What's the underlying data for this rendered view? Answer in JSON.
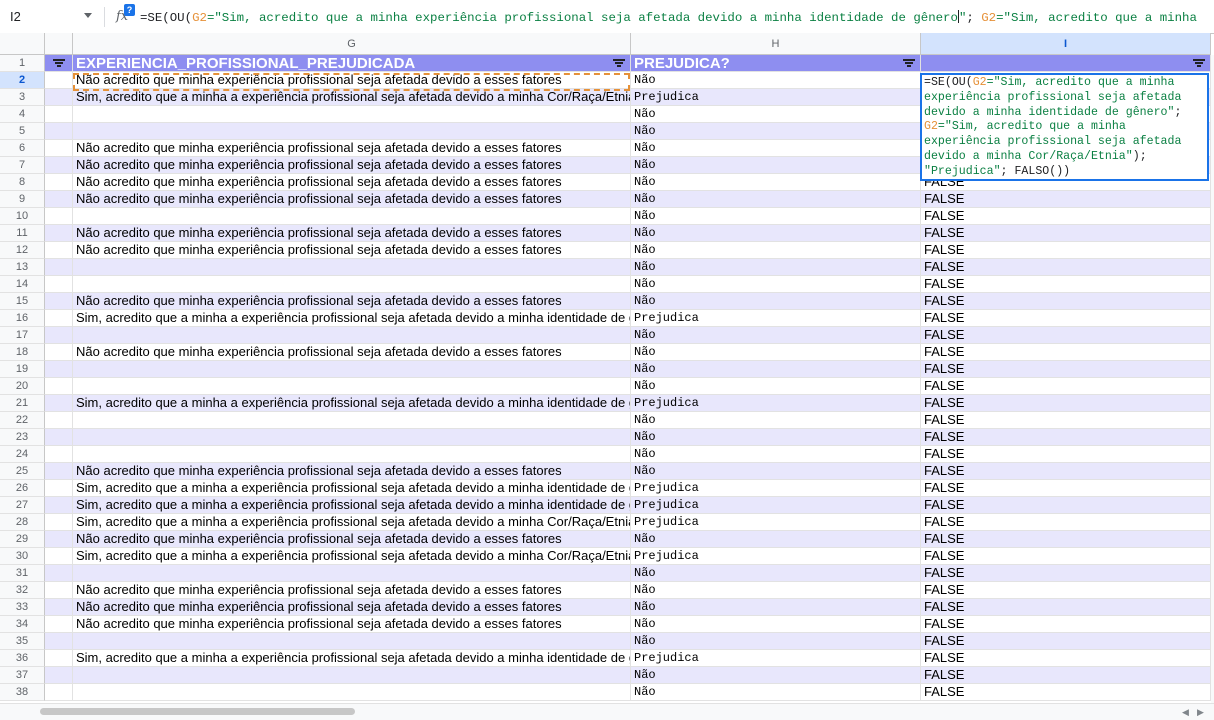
{
  "formula_bar": {
    "name_box": "I2",
    "fx_label": "fx",
    "help_badge": "?",
    "formula_seg1": "=SE(OU(",
    "formula_ref1": "G2",
    "formula_str1": "=\"Sim, acredito que a minha experiência profissional seja afetada devido a minha identidade de gênero",
    "formula_str1_end": "\"",
    "formula_sep": "; ",
    "formula_ref2": "G2",
    "formula_str2": "=\"Sim, acredito que a minha"
  },
  "columns": {
    "g": "G",
    "h": "H",
    "i": "I"
  },
  "header_row": {
    "g": "EXPERIENCIA_PROFISSIONAL_PREJUDICADA",
    "h": "PREJUDICA?",
    "i": ""
  },
  "rows": [
    {
      "num": "2",
      "g": "Não acredito que minha experiência profissional seja afetada devido a esses fatores",
      "h": "Não",
      "i": ""
    },
    {
      "num": "3",
      "g": "Sim, acredito que a minha a experiência profissional seja afetada devido a minha Cor/Raça/Etnia",
      "h": "Prejudica",
      "i": ""
    },
    {
      "num": "4",
      "g": "",
      "h": "Não",
      "i": ""
    },
    {
      "num": "5",
      "g": "",
      "h": "Não",
      "i": ""
    },
    {
      "num": "6",
      "g": "Não acredito que minha experiência profissional seja afetada devido a esses fatores",
      "h": "Não",
      "i": ""
    },
    {
      "num": "7",
      "g": "Não acredito que minha experiência profissional seja afetada devido a esses fatores",
      "h": "Não",
      "i": ""
    },
    {
      "num": "8",
      "g": "Não acredito que minha experiência profissional seja afetada devido a esses fatores",
      "h": "Não",
      "i": "FALSE"
    },
    {
      "num": "9",
      "g": "Não acredito que minha experiência profissional seja afetada devido a esses fatores",
      "h": "Não",
      "i": "FALSE"
    },
    {
      "num": "10",
      "g": "",
      "h": "Não",
      "i": "FALSE"
    },
    {
      "num": "11",
      "g": "Não acredito que minha experiência profissional seja afetada devido a esses fatores",
      "h": "Não",
      "i": "FALSE"
    },
    {
      "num": "12",
      "g": "Não acredito que minha experiência profissional seja afetada devido a esses fatores",
      "h": "Não",
      "i": "FALSE"
    },
    {
      "num": "13",
      "g": "",
      "h": "Não",
      "i": "FALSE"
    },
    {
      "num": "14",
      "g": "",
      "h": "Não",
      "i": "FALSE"
    },
    {
      "num": "15",
      "g": "Não acredito que minha experiência profissional seja afetada devido a esses fatores",
      "h": "Não",
      "i": "FALSE"
    },
    {
      "num": "16",
      "g": "Sim, acredito que a minha a experiência profissional seja afetada devido a minha identidade de gênero",
      "h": "Prejudica",
      "i": "FALSE"
    },
    {
      "num": "17",
      "g": "",
      "h": "Não",
      "i": "FALSE"
    },
    {
      "num": "18",
      "g": "Não acredito que minha experiência profissional seja afetada devido a esses fatores",
      "h": "Não",
      "i": "FALSE"
    },
    {
      "num": "19",
      "g": "",
      "h": "Não",
      "i": "FALSE"
    },
    {
      "num": "20",
      "g": "",
      "h": "Não",
      "i": "FALSE"
    },
    {
      "num": "21",
      "g": "Sim, acredito que a minha a experiência profissional seja afetada devido a minha identidade de gênero",
      "h": "Prejudica",
      "i": "FALSE"
    },
    {
      "num": "22",
      "g": "",
      "h": "Não",
      "i": "FALSE"
    },
    {
      "num": "23",
      "g": "",
      "h": "Não",
      "i": "FALSE"
    },
    {
      "num": "24",
      "g": "",
      "h": "Não",
      "i": "FALSE"
    },
    {
      "num": "25",
      "g": "Não acredito que minha experiência profissional seja afetada devido a esses fatores",
      "h": "Não",
      "i": "FALSE"
    },
    {
      "num": "26",
      "g": "Sim, acredito que a minha a experiência profissional seja afetada devido a minha identidade de gênero",
      "h": "Prejudica",
      "i": "FALSE"
    },
    {
      "num": "27",
      "g": "Sim, acredito que a minha a experiência profissional seja afetada devido a minha identidade de gênero",
      "h": "Prejudica",
      "i": "FALSE"
    },
    {
      "num": "28",
      "g": "Sim, acredito que a minha a experiência profissional seja afetada devido a minha Cor/Raça/Etnia",
      "h": "Prejudica",
      "i": "FALSE"
    },
    {
      "num": "29",
      "g": "Não acredito que minha experiência profissional seja afetada devido a esses fatores",
      "h": "Não",
      "i": "FALSE"
    },
    {
      "num": "30",
      "g": "Sim, acredito que a minha a experiência profissional seja afetada devido a minha Cor/Raça/Etnia",
      "h": "Prejudica",
      "i": "FALSE"
    },
    {
      "num": "31",
      "g": "",
      "h": "Não",
      "i": "FALSE"
    },
    {
      "num": "32",
      "g": "Não acredito que minha experiência profissional seja afetada devido a esses fatores",
      "h": "Não",
      "i": "FALSE"
    },
    {
      "num": "33",
      "g": "Não acredito que minha experiência profissional seja afetada devido a esses fatores",
      "h": "Não",
      "i": "FALSE"
    },
    {
      "num": "34",
      "g": "Não acredito que minha experiência profissional seja afetada devido a esses fatores",
      "h": "Não",
      "i": "FALSE"
    },
    {
      "num": "35",
      "g": "",
      "h": "Não",
      "i": "FALSE"
    },
    {
      "num": "36",
      "g": "Sim, acredito que a minha a experiência profissional seja afetada devido a minha identidade de gênero",
      "h": "Prejudica",
      "i": "FALSE"
    },
    {
      "num": "37",
      "g": "",
      "h": "Não",
      "i": "FALSE"
    },
    {
      "num": "38",
      "g": "",
      "h": "Não",
      "i": "FALSE"
    }
  ],
  "editor": {
    "l1a": "=SE(OU(",
    "l1ref": "G2",
    "l1b": "=\"Sim, acredito que a minha",
    "l2": "experiência profissional seja afetada",
    "l3": "devido a minha identidade de gênero\"",
    "l3b": ";",
    "l4ref": "G2",
    "l4b": "=\"Sim, acredito que a minha",
    "l5": "experiência profissional seja afetada",
    "l6": "devido a minha Cor/Raça/Etnia\"",
    "l6b": ");",
    "l7str": "\"Prejudica\"",
    "l7b": "; FALSO())"
  },
  "colors": {
    "header_fill": "#8e8ef0",
    "band_fill": "#e8e7fc",
    "selection": "#1a73e8",
    "copy_border": "#e69138",
    "reference": "#e69138",
    "string": "#0b8043"
  }
}
